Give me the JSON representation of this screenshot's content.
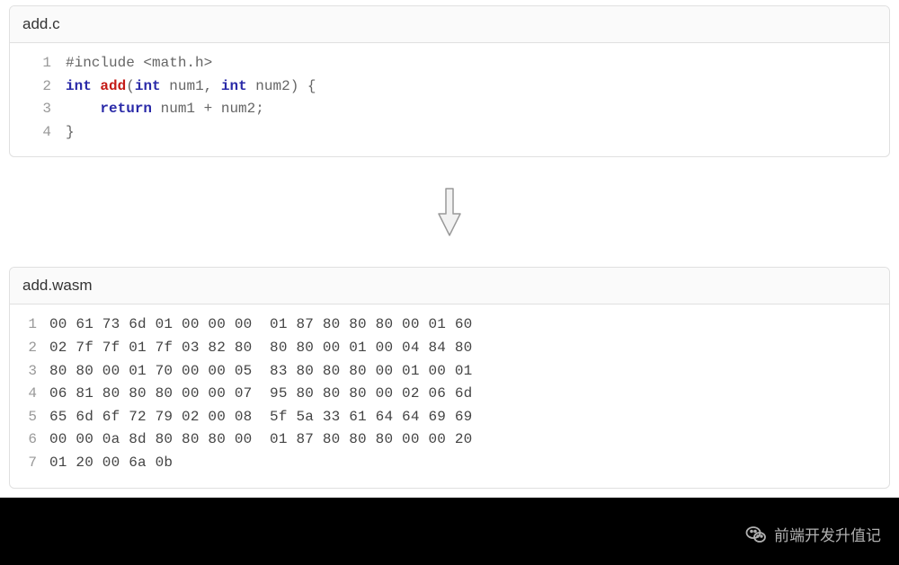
{
  "top_card": {
    "filename": "add.c",
    "code_lines": [
      {
        "n": "1",
        "segments": [
          {
            "cls": "tok-pre",
            "t": "#include "
          },
          {
            "cls": "tok-angle",
            "t": "<math.h>"
          }
        ]
      },
      {
        "n": "2",
        "segments": [
          {
            "cls": "tok-kw",
            "t": "int"
          },
          {
            "cls": "tok-punc",
            "t": " "
          },
          {
            "cls": "tok-fn",
            "t": "add"
          },
          {
            "cls": "tok-punc",
            "t": "("
          },
          {
            "cls": "tok-kw",
            "t": "int"
          },
          {
            "cls": "tok-id",
            "t": " num1"
          },
          {
            "cls": "tok-punc",
            "t": ", "
          },
          {
            "cls": "tok-kw",
            "t": "int"
          },
          {
            "cls": "tok-id",
            "t": " num2"
          },
          {
            "cls": "tok-punc",
            "t": ") {"
          }
        ]
      },
      {
        "n": "3",
        "segments": [
          {
            "cls": "tok-punc",
            "t": "    "
          },
          {
            "cls": "tok-kw",
            "t": "return"
          },
          {
            "cls": "tok-id",
            "t": " num1 "
          },
          {
            "cls": "tok-punc",
            "t": "+"
          },
          {
            "cls": "tok-id",
            "t": " num2"
          },
          {
            "cls": "tok-punc",
            "t": ";"
          }
        ]
      },
      {
        "n": "4",
        "segments": [
          {
            "cls": "tok-punc",
            "t": "}"
          }
        ]
      }
    ]
  },
  "bottom_card": {
    "filename": "add.wasm",
    "hex_lines": [
      {
        "n": "1",
        "t": "00 61 73 6d 01 00 00 00  01 87 80 80 80 00 01 60"
      },
      {
        "n": "2",
        "t": "02 7f 7f 01 7f 03 82 80  80 80 00 01 00 04 84 80"
      },
      {
        "n": "3",
        "t": "80 80 00 01 70 00 00 05  83 80 80 80 00 01 00 01"
      },
      {
        "n": "4",
        "t": "06 81 80 80 80 00 00 07  95 80 80 80 00 02 06 6d"
      },
      {
        "n": "5",
        "t": "65 6d 6f 72 79 02 00 08  5f 5a 33 61 64 64 69 69"
      },
      {
        "n": "6",
        "t": "00 00 0a 8d 80 80 80 00  01 87 80 80 80 00 00 20"
      },
      {
        "n": "7",
        "t": "01 20 00 6a 0b"
      }
    ]
  },
  "watermark_text": "前端开发升值记"
}
